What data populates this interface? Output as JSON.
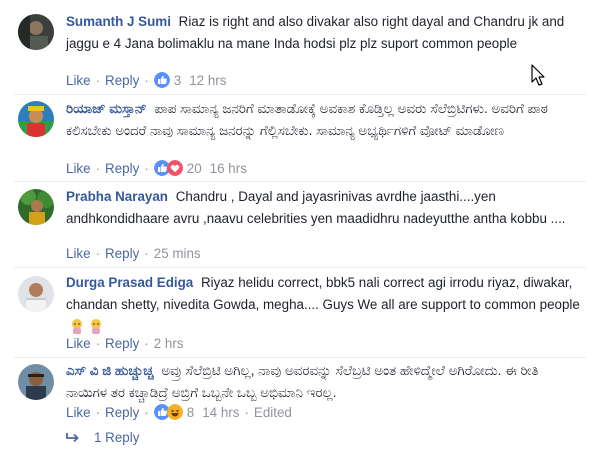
{
  "comments": [
    {
      "author": "Sumanth J Sumi",
      "text": "Riaz is right and also divakar also right dayal and Chandru jk and jaggu e 4 Jana bolimaklu na mane Inda hodsi plz plz suport common people",
      "actions": {
        "like": "Like",
        "reply": "Reply",
        "count": "3",
        "time": "12 hrs"
      }
    },
    {
      "author": "ರಿಯಾಜ್ ಮಸ್ತಾನ್",
      "text": "ಪಾಪ ಸಾಮಾನ್ಯ ಜನರಿಗೆ ಮಾತಾಡೋಕ್ಕೆ ಅವಕಾಶ ಕೊಡ್ತಿಲ್ಲ ಅವರು ಸೆಲೆಬ್ರಿಟಿಗಳು. ಅವರಿಗೆ ಪಾಠ ಕಲಿಸಬೇಕು ಅಂದರೆ ನಾವು ಸಾಮಾನ್ಯ ಜನರನ್ನು ಗೆಲ್ಲಿಸಬೇಕು. ಸಾಮಾನ್ಯ ಅಭ್ಯರ್ಥಿಗಳಿಗೆ ವೋಟ್ ಮಾಡೋಣ",
      "actions": {
        "like": "Like",
        "reply": "Reply",
        "count": "20",
        "time": "16 hrs"
      }
    },
    {
      "author": "Prabha Narayan",
      "text": "Chandru , Dayal and jayasrinivas avrdhe jaasthi....yen andhkondidhaare avru ,naavu celebrities yen maadidhru nadeyutthe antha kobbu ....",
      "actions": {
        "like": "Like",
        "reply": "Reply",
        "time": "25 mins"
      }
    },
    {
      "author": "Durga Prasad Ediga",
      "text": "Riyaz helidu correct, bbk5 nali correct agi irrodu riyaz, diwakar, chandan shetty, nivedita Gowda, megha.... Guys We all are support to common people",
      "actions": {
        "like": "Like",
        "reply": "Reply",
        "time": "2 hrs"
      }
    },
    {
      "author": "ಎಸ್ ವಿ ಜಿ ಹುಚ್ಚುಚ್ಚ",
      "text": "ಅವ್ರು ಸೆಲೆಬ್ರಿಟಿ ಅಗಿಲ್ಲ, ನಾವು ಅವರವನ್ನು ಸೆಲೆಬ್ರಟಿ ಅಂತ ಹೇಳಿದ್ಮೇಲೆ ಅಗಿರೋದು. ಈ ರೀತಿ ನಾಯಿಗಳ ತರ ಕಚ್ಚಾಡಿದ್ರೆ ಅಬ್ರಿಗೆ ಒಬ್ಬನೇ ಒಬ್ಬ ಅಭಿಮಾನಿ ಇರಲ್ಲ.",
      "actions": {
        "like": "Like",
        "reply": "Reply",
        "count": "8",
        "time": "14 hrs",
        "edited": "Edited"
      }
    }
  ],
  "replies_link": "1 Reply",
  "colors": {
    "author": "#365899",
    "text": "#1d2129",
    "meta": "#90949c",
    "link": "#4b67a1",
    "like_blue": "#5890ff",
    "divider": "#e9ebee"
  },
  "icons": {
    "reaction_like": "thumbs-up-icon",
    "reaction_laugh": "haha-icon",
    "cursor": "mouse-pointer-icon",
    "reply_arrow": "reply-arrow-icon"
  }
}
